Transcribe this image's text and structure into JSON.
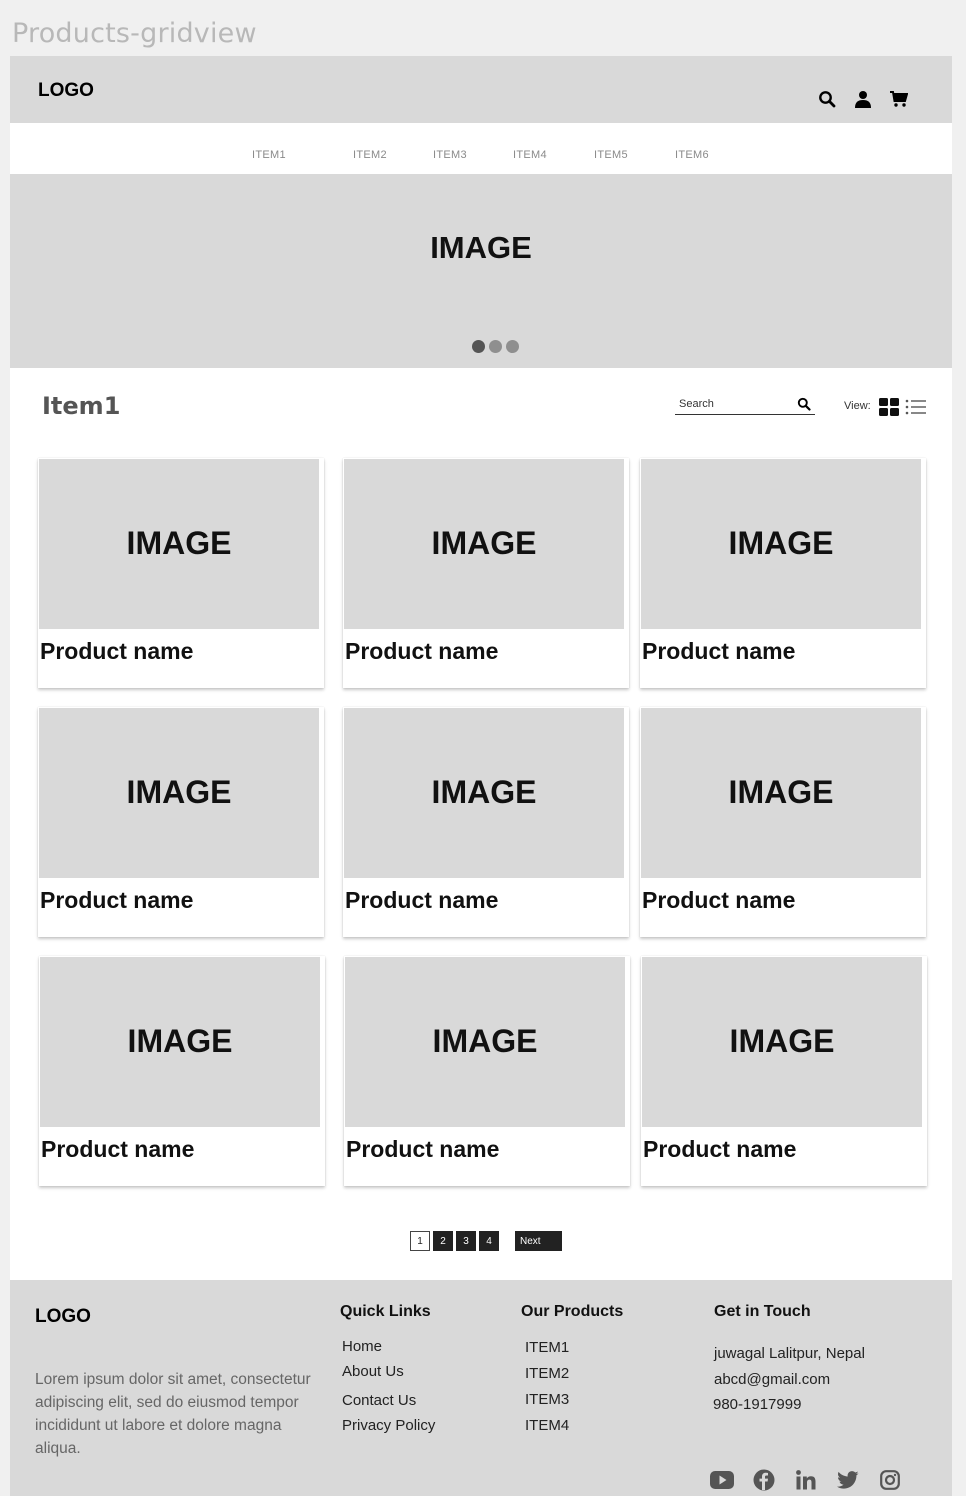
{
  "frame_title": "Products-gridview",
  "header": {
    "logo": "LOGO",
    "icons": [
      "search-icon",
      "user-icon",
      "cart-icon"
    ]
  },
  "nav": {
    "items": [
      "ITEM1",
      "ITEM2",
      "ITEM3",
      "ITEM4",
      "ITEM5",
      "ITEM6"
    ]
  },
  "hero": {
    "label": "IMAGE",
    "slides": 3,
    "active_slide": 1
  },
  "listing": {
    "title": "Item1",
    "search_placeholder": "Search",
    "view_label": "View:",
    "view_modes": [
      "grid",
      "list"
    ],
    "active_view": "grid"
  },
  "products": [
    {
      "image_label": "IMAGE",
      "name": "Product name"
    },
    {
      "image_label": "IMAGE",
      "name": "Product name"
    },
    {
      "image_label": "IMAGE",
      "name": "Product name"
    },
    {
      "image_label": "IMAGE",
      "name": "Product name"
    },
    {
      "image_label": "IMAGE",
      "name": "Product name"
    },
    {
      "image_label": "IMAGE",
      "name": "Product name"
    },
    {
      "image_label": "IMAGE",
      "name": "Product name"
    },
    {
      "image_label": "IMAGE",
      "name": "Product name"
    },
    {
      "image_label": "IMAGE",
      "name": "Product name"
    }
  ],
  "pagination": {
    "pages": [
      "1",
      "2",
      "3",
      "4"
    ],
    "current": "1",
    "next_label": "Next"
  },
  "footer": {
    "logo": "LOGO",
    "description": "Lorem ipsum dolor sit amet, consectetur adipiscing elit, sed do eiusmod tempor incididunt ut labore et dolore magna aliqua.",
    "quick_links": {
      "title": "Quick Links",
      "items": [
        "Home",
        "About Us",
        "Contact Us",
        "Privacy Policy"
      ]
    },
    "our_products": {
      "title": "Our Products",
      "items": [
        "ITEM1",
        "ITEM2",
        "ITEM3",
        "ITEM4"
      ]
    },
    "contact": {
      "title": "Get in Touch",
      "address": "juwagal Lalitpur, Nepal",
      "email": "abcd@gmail.com",
      "phone": "980-1917999"
    },
    "socials": [
      "youtube-icon",
      "facebook-icon",
      "linkedin-icon",
      "twitter-icon",
      "instagram-icon"
    ]
  }
}
